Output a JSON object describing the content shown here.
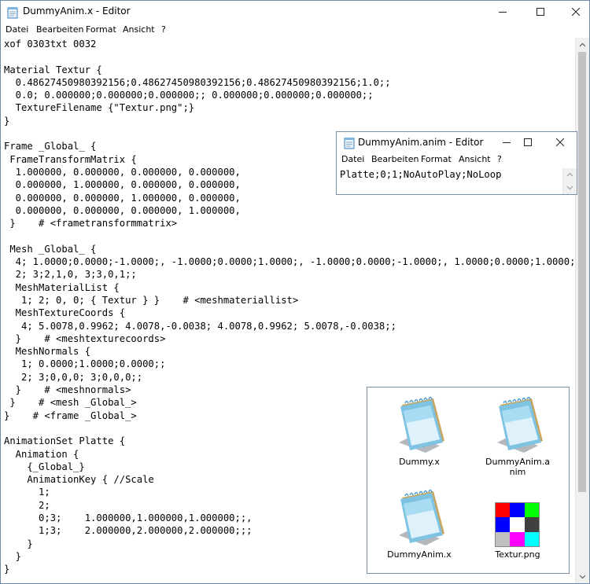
{
  "main_window": {
    "title": "DummyAnim.x - Editor",
    "menu": [
      "Datei",
      "Bearbeiten",
      "Format",
      "Ansicht",
      "?"
    ],
    "text": "xof 0303txt 0032\n\nMaterial Textur {\n  0.48627450980392156;0.48627450980392156;0.48627450980392156;1.0;;\n  0.0; 0.000000;0.000000;0.000000;; 0.000000;0.000000;0.000000;;\n  TextureFilename {\"Textur.png\";}\n}\n\nFrame _Global_ {\n FrameTransformMatrix {\n  1.000000, 0.000000, 0.000000, 0.000000,\n  0.000000, 1.000000, 0.000000, 0.000000,\n  0.000000, 0.000000, 1.000000, 0.000000,\n  0.000000, 0.000000, 0.000000, 1.000000,\n }    # <frametransformmatrix>\n\n Mesh _Global_ {\n  4; 1.0000;0.0000;-1.0000;, -1.0000;0.0000;1.0000;, -1.0000;0.0000;-1.0000;, 1.0000;0.0000;1.0000;;\n  2; 3;2,1,0, 3;3,0,1;;\n  MeshMaterialList {\n   1; 2; 0, 0; { Textur } }    # <meshmateriallist>\n  MeshTextureCoords {\n   4; 5.0078,0.9962; 4.0078,-0.0038; 4.0078,0.9962; 5.0078,-0.0038;;\n  }    # <meshtexturecoords>\n  MeshNormals {\n   1; 0.0000;1.0000;0.0000;;\n   2; 3;0,0,0; 3;0,0,0;;\n  }    # <meshnormals>\n }    # <mesh _Global_>\n}    # <frame _Global_>\n\nAnimationSet Platte {\n  Animation {\n    {_Global_}\n    AnimationKey { //Scale\n      1;\n      2;\n      0;3;    1.000000,1.000000,1.000000;;,\n      1;3;    2.000000,2.000000,2.000000;;;\n    }\n  }\n}"
  },
  "anim_window": {
    "title": "DummyAnim.anim - Editor",
    "menu": [
      "Datei",
      "Bearbeiten",
      "Format",
      "Ansicht",
      "?"
    ],
    "text": "Platte;0;1;NoAutoPlay;NoLoop"
  },
  "explorer": {
    "files": [
      {
        "name": "Dummy.x",
        "icon": "notepad-file-icon"
      },
      {
        "name": "DummyAnim.anim",
        "icon": "notepad-file-icon"
      },
      {
        "name": "DummyAnim.x",
        "icon": "notepad-file-icon"
      },
      {
        "name": "Textur.png",
        "icon": "color-grid-image-icon"
      }
    ],
    "texture_colors": [
      "#ff0000",
      "#0000ff",
      "#00ff00",
      "#0000ff",
      "#ffffff",
      "#404040",
      "#c0c0c0",
      "#ff00ff",
      "#00ffff"
    ]
  },
  "colors": {
    "window_border": "#6e8aa8",
    "close_hover": "#e81123"
  }
}
